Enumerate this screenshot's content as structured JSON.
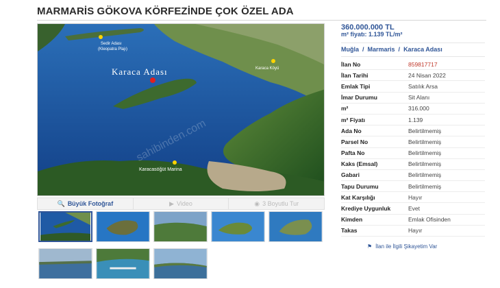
{
  "listing": {
    "title": "MARMARİS GÖKOVA KÖRFEZİNDE ÇOK ÖZEL ADA",
    "price": "360.000.000 TL",
    "m2_price_label": "m² fiyatı: 1.139 TL/m²"
  },
  "location": {
    "city": "Muğla",
    "district": "Marmaris",
    "area": "Karaca Adası",
    "separator": "/"
  },
  "photo": {
    "labels": {
      "main_island": "Karaca Adası",
      "sedir": "Sedir Adası",
      "sedir_sub": "(Kleopatra Plajı)",
      "karaca_koyu": "Karaca Köyü",
      "marina": "Karacasöğüt Marina",
      "watermark": "sahibinden.com"
    },
    "tabs": [
      {
        "label": "Büyük Fotoğraf",
        "icon": "search-icon"
      },
      {
        "label": "Video",
        "icon": "play-icon"
      },
      {
        "label": "3 Boyutlu Tur",
        "icon": "camera-icon"
      }
    ],
    "thumb_count": 8
  },
  "details": [
    {
      "key": "İlan No",
      "value": "859817717",
      "highlight": true
    },
    {
      "key": "İlan Tarihi",
      "value": "24 Nisan 2022"
    },
    {
      "key": "Emlak Tipi",
      "value": "Satılık Arsa"
    },
    {
      "key": "İmar Durumu",
      "value": "Sit Alanı"
    },
    {
      "key": "m²",
      "value": "316.000"
    },
    {
      "key": "m² Fiyatı",
      "value": "1.139"
    },
    {
      "key": "Ada No",
      "value": "Belirtilmemiş"
    },
    {
      "key": "Parsel No",
      "value": "Belirtilmemiş"
    },
    {
      "key": "Pafta No",
      "value": "Belirtilmemiş"
    },
    {
      "key": "Kaks (Emsal)",
      "value": "Belirtilmemiş"
    },
    {
      "key": "Gabari",
      "value": "Belirtilmemiş"
    },
    {
      "key": "Tapu Durumu",
      "value": "Belirtilmemiş"
    },
    {
      "key": "Kat Karşılığı",
      "value": "Hayır"
    },
    {
      "key": "Krediye Uygunluk",
      "value": "Evet"
    },
    {
      "key": "Kimden",
      "value": "Emlak Ofisinden"
    },
    {
      "key": "Takas",
      "value": "Hayır"
    }
  ],
  "complain_label": "İlan ile İlgili Şikayetim Var",
  "colors": {
    "accent": "#2f5597",
    "highlight": "#c0392b",
    "sea": "#1a4f9c",
    "land": "#2f6b2a"
  }
}
